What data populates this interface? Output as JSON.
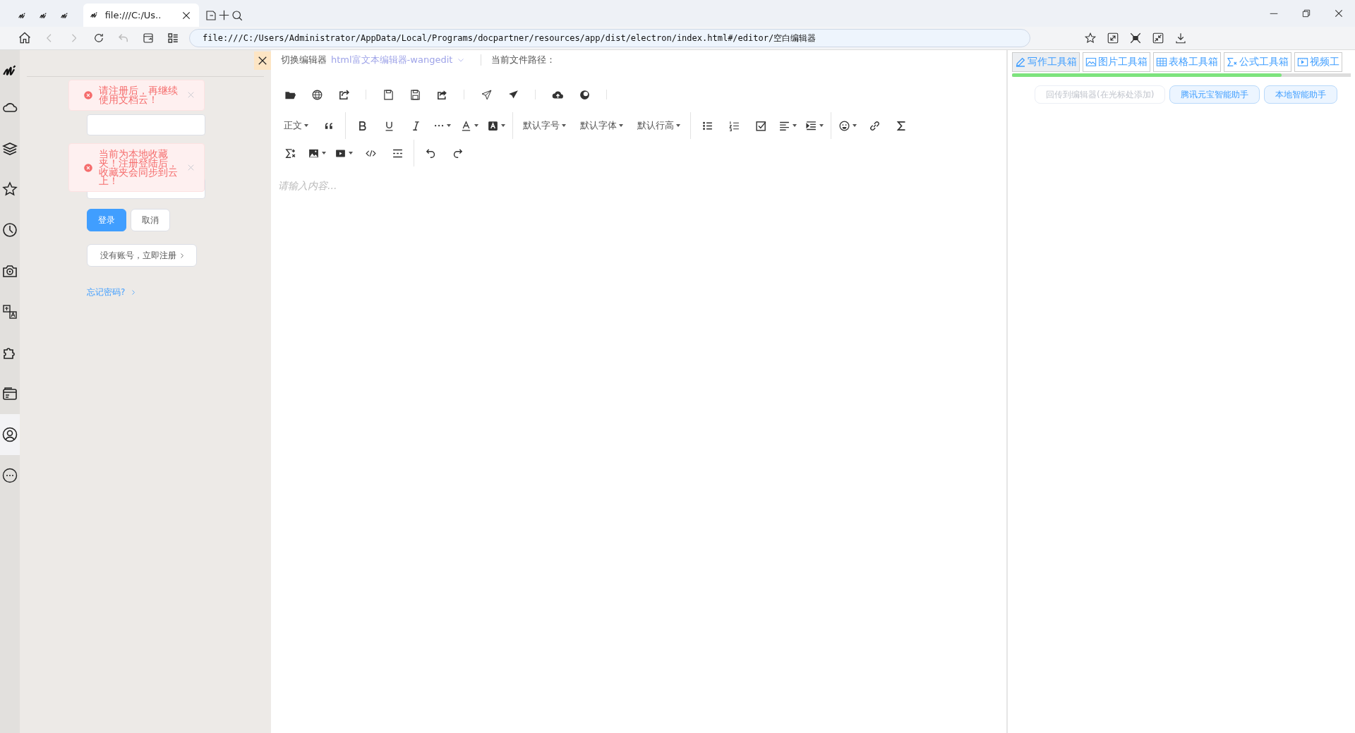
{
  "browser": {
    "tabs": [
      {
        "selected": false
      },
      {
        "selected": false
      },
      {
        "selected": false
      },
      {
        "title": "file:///C:/Us..",
        "selected": true
      }
    ],
    "address": "file:///C:/Users/Administrator/AppData/Local/Programs/docpartner/resources/app/dist/electron/index.html#/editor/空白编辑器"
  },
  "sidebar": {
    "items": [
      {
        "selected": false
      },
      {
        "selected": false
      },
      {
        "selected": false
      },
      {
        "selected": false
      },
      {
        "selected": false
      },
      {
        "selected": false
      },
      {
        "selected": false
      },
      {
        "selected": false
      },
      {
        "selected": true
      },
      {
        "selected": false
      }
    ]
  },
  "login": {
    "toasts": [
      {
        "text": "请注册后，再继续使用文档云！"
      },
      {
        "text": "当前为本地收藏夹！注册登陆后，收藏夹会同步到云上！"
      }
    ],
    "buttons": [
      {
        "label": "登录",
        "kind": "primary"
      },
      {
        "label": "取消",
        "kind": "default"
      }
    ],
    "register": "没有账号，立即注册",
    "forgot": "忘记密码?"
  },
  "editor": {
    "switch_label": "切换编辑器",
    "editor_name": "html富文本编辑器-wangedit",
    "path_label": "当前文件路径：",
    "toolbar_labels": [
      "正文",
      "默认字号",
      "默认字体",
      "默认行高"
    ],
    "placeholder": "请输入内容..."
  },
  "tools": {
    "tabs": [
      {
        "label": "写作工具箱",
        "selected": true
      },
      {
        "label": "图片工具箱",
        "selected": false
      },
      {
        "label": "表格工具箱",
        "selected": false
      },
      {
        "label": "公式工具箱",
        "selected": false
      },
      {
        "label": "视频工",
        "selected": false
      }
    ],
    "buttons": [
      {
        "label": "回传到编辑器(在光标处添加)",
        "disabled": true
      },
      {
        "label": "腾讯元宝智能助手",
        "disabled": false
      },
      {
        "label": "本地智能助手",
        "disabled": false
      }
    ]
  }
}
